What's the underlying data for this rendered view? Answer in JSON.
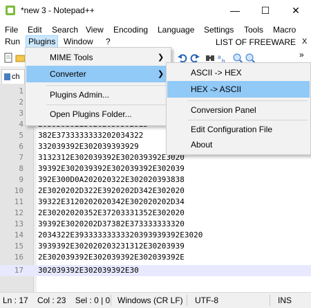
{
  "window": {
    "title": "*new 3 - Notepad++",
    "minimize": "—",
    "maximize": "☐",
    "close": "✕"
  },
  "menubar": {
    "row1": [
      "File",
      "Edit",
      "Search",
      "View",
      "Encoding",
      "Language",
      "Settings",
      "Tools",
      "Macro"
    ],
    "row2": [
      "Run",
      "Plugins",
      "Window",
      "?"
    ],
    "close_doc": "X",
    "watermark": "LIST OF FREEWARE",
    "overflow": "»"
  },
  "tab": {
    "label": "ch"
  },
  "plugins_menu": {
    "items": [
      "MIME Tools",
      "Converter",
      "Plugins Admin...",
      "Open Plugins Folder..."
    ]
  },
  "converter_submenu": {
    "items": [
      "ASCII -> HEX",
      "HEX -> ASCII",
      "Conversion Panel",
      "Edit Configuration File",
      "About"
    ]
  },
  "editor": {
    "lines": [
      {
        "n": "1",
        "t": ""
      },
      {
        "n": "2",
        "t": ""
      },
      {
        "n": "3",
        "t": ""
      },
      {
        "n": "4",
        "t": "203939392E302020393929E3"
      },
      {
        "n": "5",
        "t": "382E3733333333202034322"
      },
      {
        "n": "6",
        "t": "332039392E302039393929"
      },
      {
        "n": "7",
        "t": "3132312E302039392E302039392E3020"
      },
      {
        "n": "8",
        "t": "39392E302039392E302039392E302039"
      },
      {
        "n": "9",
        "t": "392E300D0A202020322E302020393838"
      },
      {
        "n": "10",
        "t": "2E3020202D322E3920202D342E302020"
      },
      {
        "n": "11",
        "t": "39322E3120202020342E302020202D34"
      },
      {
        "n": "12",
        "t": "2E30202020352E37203331352E302020"
      },
      {
        "n": "13",
        "t": "39392E3020202D37382E373333333320"
      },
      {
        "n": "14",
        "t": "2034322E39333333333320393939392E3020"
      },
      {
        "n": "15",
        "t": "3939392E302020203231312E30203939"
      },
      {
        "n": "16",
        "t": "2E302039392E302039392E302039392E"
      },
      {
        "n": "17",
        "t": "302039392E302039392E30"
      }
    ]
  },
  "status": {
    "position": "Ln : 17    Col : 23    Sel : 0 | 0",
    "eol": "Windows (CR LF)",
    "encoding": "UTF-8",
    "mode": "INS"
  }
}
